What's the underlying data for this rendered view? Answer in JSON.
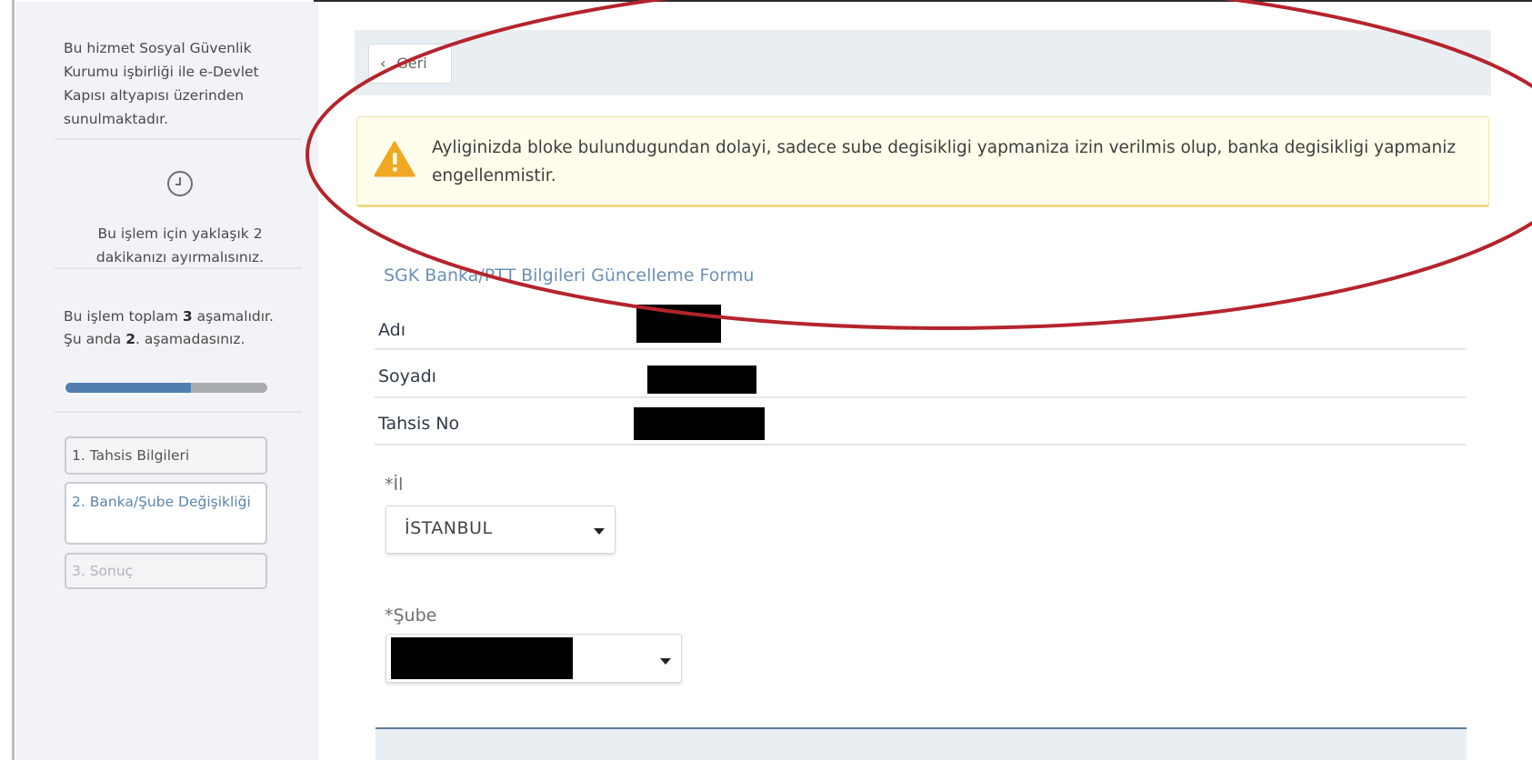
{
  "sidebar": {
    "info_text": "Bu hizmet Sosyal Güvenlik Kurumu işbirliği ile e-Devlet Kapısı altyapısı üzerinden sunulmaktadır.",
    "time_text": "Bu işlem için yaklaşık 2 dakikanızı ayırmalısınız.",
    "steps_text": {
      "prefix": "Bu işlem toplam ",
      "total": "3",
      "middle": " aşamalıdır. Şu anda ",
      "current": "2",
      "suffix": ". aşamadasınız."
    },
    "progress_fraction": 0.62,
    "steps": [
      {
        "label": "1. Tahsis Bilgileri",
        "state": "done"
      },
      {
        "label": "2. Banka/Şube Değişikliği",
        "state": "active"
      },
      {
        "label": "3. Sonuç",
        "state": "disabled"
      }
    ]
  },
  "header": {
    "back_label": "Geri"
  },
  "alert": {
    "text": "Ayliginizda bloke bulundugundan dolayi, sadece sube degisikligi yapmaniza izin verilmis olup, banka degisikligi yapmaniz engellenmistir."
  },
  "form": {
    "title": "SGK Banka/PTT Bilgileri Güncelleme Formu",
    "rows": [
      {
        "label": "Adı"
      },
      {
        "label": "Soyadı"
      },
      {
        "label": "Tahsis No"
      }
    ],
    "il_label": "*İl",
    "il_value": "İSTANBUL",
    "sube_label": "*Şube"
  },
  "colors": {
    "accent_blue": "#4f7fad",
    "alert_bg": "#fffdeb",
    "annotation_red": "#b5242c"
  }
}
